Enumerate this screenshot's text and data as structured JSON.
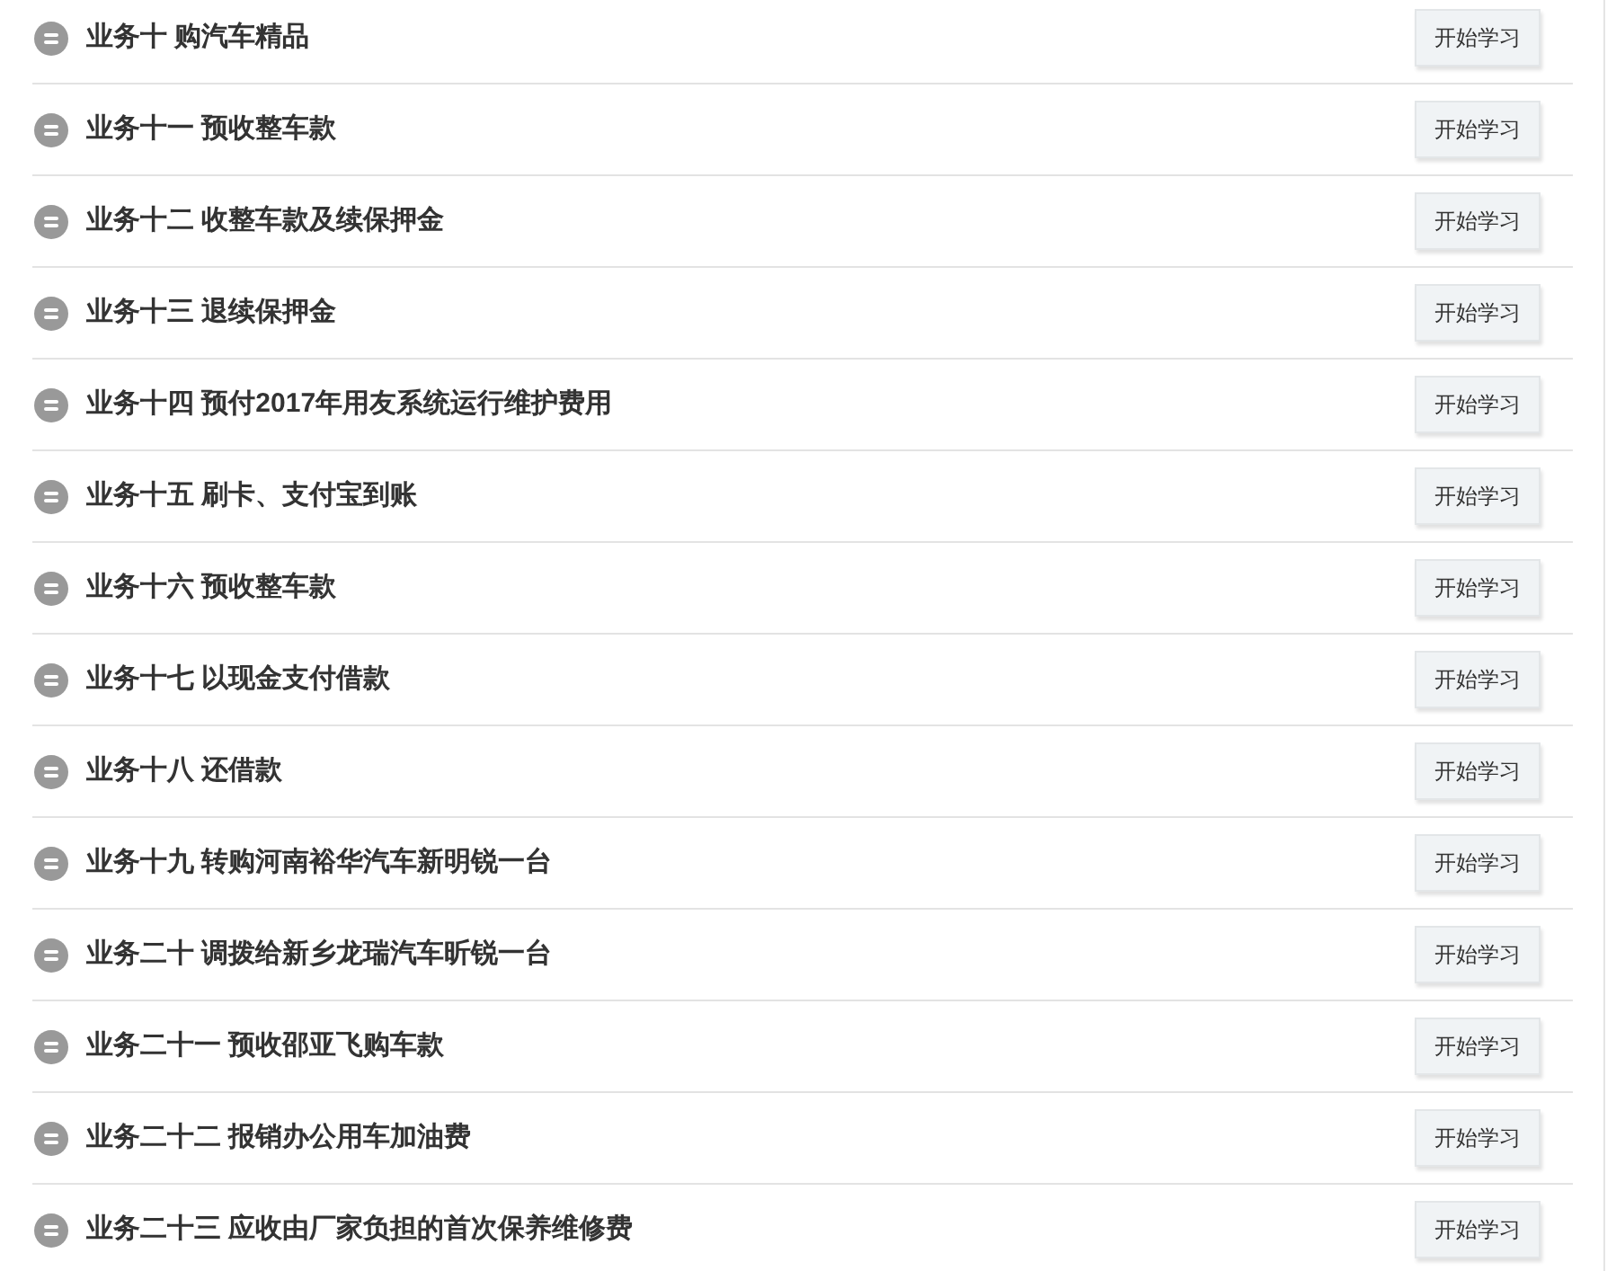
{
  "items": [
    {
      "title": "业务十 购汽车精品",
      "button": "开始学习"
    },
    {
      "title": "业务十一 预收整车款",
      "button": "开始学习"
    },
    {
      "title": "业务十二 收整车款及续保押金",
      "button": "开始学习"
    },
    {
      "title": "业务十三 退续保押金",
      "button": "开始学习"
    },
    {
      "title": "业务十四 预付2017年用友系统运行维护费用",
      "button": "开始学习"
    },
    {
      "title": "业务十五 刷卡、支付宝到账",
      "button": "开始学习"
    },
    {
      "title": "业务十六 预收整车款",
      "button": "开始学习"
    },
    {
      "title": "业务十七 以现金支付借款",
      "button": "开始学习"
    },
    {
      "title": "业务十八 还借款",
      "button": "开始学习"
    },
    {
      "title": "业务十九 转购河南裕华汽车新明锐一台",
      "button": "开始学习"
    },
    {
      "title": "业务二十 调拨给新乡龙瑞汽车昕锐一台",
      "button": "开始学习"
    },
    {
      "title": "业务二十一 预收邵亚飞购车款",
      "button": "开始学习"
    },
    {
      "title": "业务二十二 报销办公用车加油费",
      "button": "开始学习"
    },
    {
      "title": "业务二十三 应收由厂家负担的首次保养维修费",
      "button": "开始学习"
    }
  ]
}
